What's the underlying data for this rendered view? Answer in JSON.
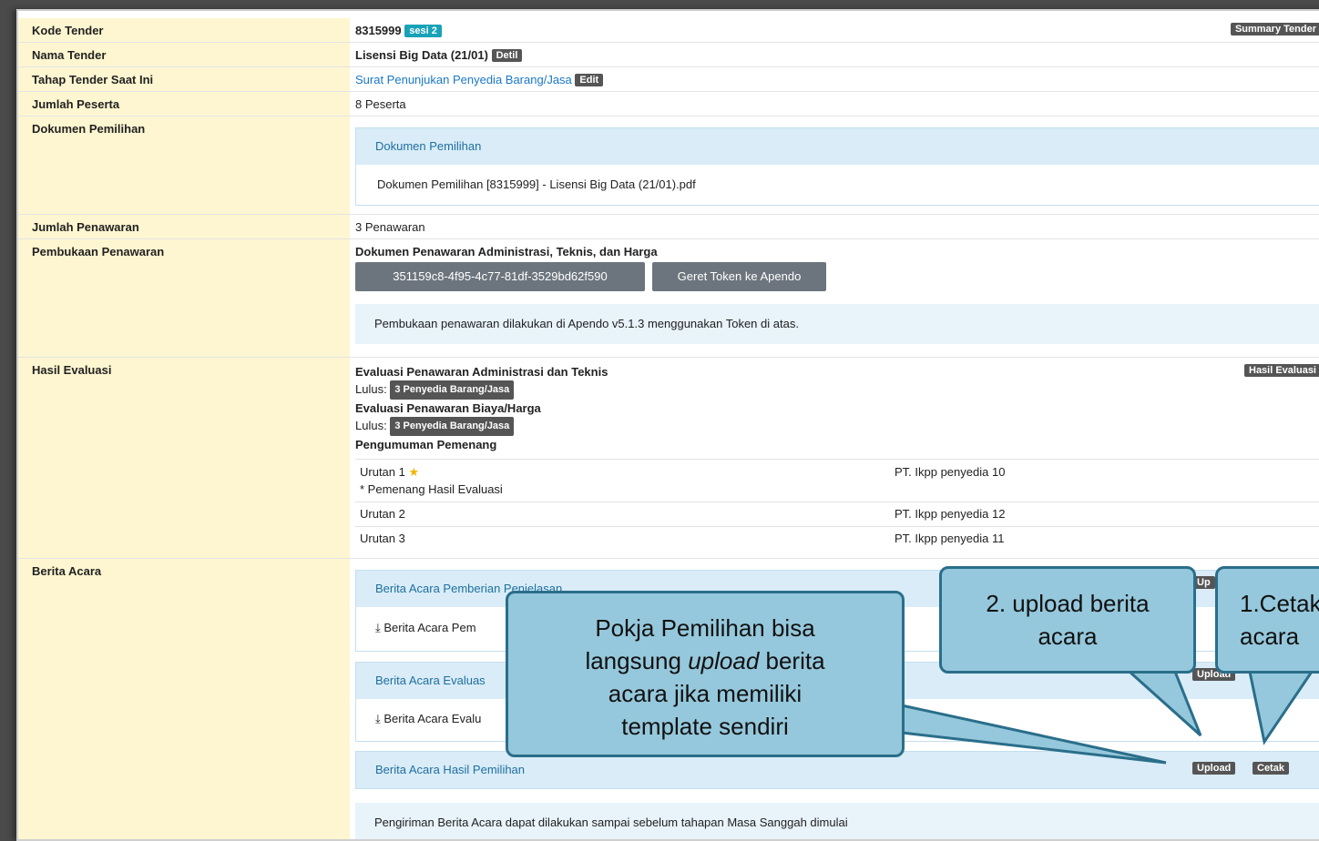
{
  "rows": {
    "kode_tender": {
      "label": "Kode Tender",
      "value": "8315999",
      "badge": "sesi 2",
      "right_button": "Summary Tender"
    },
    "nama_tender": {
      "label": "Nama Tender",
      "value": "Lisensi Big Data (21/01)",
      "badge": "Detil"
    },
    "tahap": {
      "label": "Tahap Tender Saat Ini",
      "value": "Surat Penunjukan Penyedia Barang/Jasa",
      "badge": "Edit"
    },
    "jumlah_peserta": {
      "label": "Jumlah Peserta",
      "value": "8 Peserta"
    },
    "dokumen_pemilihan": {
      "label": "Dokumen Pemilihan",
      "panel_title": "Dokumen Pemilihan",
      "file": "Dokumen Pemilihan [8315999] - Lisensi Big Data (21/01).pdf"
    },
    "jumlah_penawaran": {
      "label": "Jumlah Penawaran",
      "value": "3 Penawaran"
    },
    "pembukaan": {
      "label": "Pembukaan Penawaran",
      "title": "Dokumen Penawaran Administrasi, Teknis, dan Harga",
      "token": "351159c8-4f95-4c77-81df-3529bd62f590",
      "geret_button": "Geret Token ke Apendo",
      "info": "Pembukaan penawaran dilakukan di Apendo v5.1.3 menggunakan Token di atas."
    },
    "hasil_evaluasi": {
      "label": "Hasil Evaluasi",
      "right_button": "Hasil Evaluasi",
      "eval1_title": "Evaluasi Penawaran Administrasi dan Teknis",
      "lulus_label": "Lulus:",
      "eval1_badge": "3 Penyedia Barang/Jasa",
      "eval2_title": "Evaluasi Penawaran Biaya/Harga",
      "eval2_badge": "3 Penyedia Barang/Jasa",
      "pengumuman_title": "Pengumuman Pemenang",
      "winners": [
        {
          "rank": "Urutan 1",
          "star": "★",
          "note": "* Pemenang Hasil Evaluasi",
          "name": "PT. Ikpp penyedia 10"
        },
        {
          "rank": "Urutan 2",
          "name": "PT. Ikpp penyedia 12"
        },
        {
          "rank": "Urutan 3",
          "name": "PT. Ikpp penyedia 11"
        }
      ]
    },
    "berita_acara": {
      "label": "Berita Acara",
      "panel1_title": "Berita Acara Pemberian Penjelasan",
      "panel1_file": "Berita Acara Pem",
      "panel1_btn": "Up",
      "panel2_title": "Berita Acara Evaluas",
      "panel2_file": "Berita Acara Evalu",
      "panel2_btn": "Upload",
      "panel3_title": "Berita Acara Hasil Pemilihan",
      "upload_button": "Upload",
      "cetak_button": "Cetak",
      "footer_info": "Pengiriman Berita Acara dapat dilakukan sampai sebelum tahapan Masa Sanggah dimulai"
    }
  },
  "callouts": {
    "pokja": {
      "line1": "Pokja Pemilihan bisa",
      "line2a": "langsung ",
      "line2_em": "upload",
      "line2b": " berita",
      "line3": "acara jika memiliki",
      "line4": "template sendiri"
    },
    "upload": {
      "line1": "2. upload berita",
      "line2": "acara"
    },
    "cetak": {
      "line1": "1.Cetak",
      "line2": "acara"
    }
  },
  "colors": {
    "label_bg": "#fdf6d0",
    "panel_head": "#d9ecf7",
    "callout_fill": "#95c8dc",
    "callout_stroke": "#2a6e8a",
    "badge_teal": "#17a2b8"
  }
}
